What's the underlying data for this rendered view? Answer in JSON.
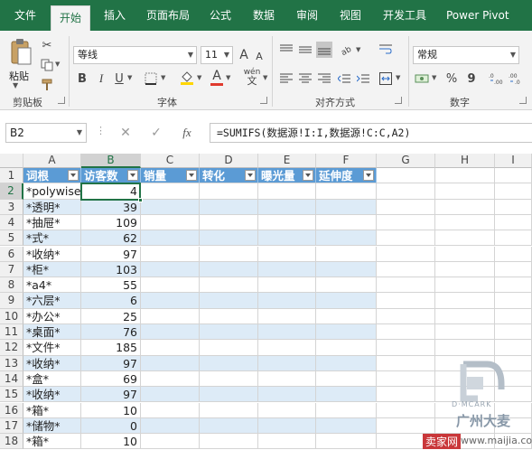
{
  "ribbon": {
    "tabs": [
      "文件",
      "开始",
      "插入",
      "页面布局",
      "公式",
      "数据",
      "审阅",
      "视图",
      "开发工具",
      "Power Pivot"
    ],
    "active_tab": "开始",
    "clipboard": {
      "paste_label": "粘贴",
      "group_label": "剪贴板"
    },
    "font": {
      "name": "等线",
      "size": "11",
      "bold": "B",
      "italic": "I",
      "underline": "U",
      "wen": "wén",
      "grow": "A",
      "shrink": "A",
      "group_label": "字体"
    },
    "alignment": {
      "group_label": "对齐方式"
    },
    "number": {
      "format": "常规",
      "percent": "%",
      "comma": "9",
      "group_label": "数字"
    }
  },
  "formula_bar": {
    "name_box": "B2",
    "fx": "fx",
    "formula": "=SUMIFS(数据源!I:I,数据源!C:C,A2)"
  },
  "sheet": {
    "columns": [
      "A",
      "B",
      "C",
      "D",
      "E",
      "F",
      "G",
      "H",
      "I"
    ],
    "selected_column": "B",
    "selected_row": "2",
    "headers": [
      "词根",
      "访客数",
      "销量",
      "转化",
      "曝光量",
      "延伸度"
    ],
    "row_numbers": [
      "1",
      "2",
      "3",
      "4",
      "5",
      "6",
      "7",
      "8",
      "9",
      "10",
      "11",
      "12",
      "13",
      "14",
      "15",
      "16",
      "17",
      "18"
    ],
    "rows": [
      {
        "word": "*polywise*",
        "visitors": "4"
      },
      {
        "word": "*透明*",
        "visitors": "39"
      },
      {
        "word": "*抽屉*",
        "visitors": "109"
      },
      {
        "word": "*式*",
        "visitors": "62"
      },
      {
        "word": "*收纳*",
        "visitors": "97"
      },
      {
        "word": "*柜*",
        "visitors": "103"
      },
      {
        "word": "*a4*",
        "visitors": "55"
      },
      {
        "word": "*六层*",
        "visitors": "6"
      },
      {
        "word": "*办公*",
        "visitors": "25"
      },
      {
        "word": "*桌面*",
        "visitors": "76"
      },
      {
        "word": "*文件*",
        "visitors": "185"
      },
      {
        "word": "*收纳*",
        "visitors": "97"
      },
      {
        "word": "*盒*",
        "visitors": "69"
      },
      {
        "word": "*收纳*",
        "visitors": "97"
      },
      {
        "word": "*箱*",
        "visitors": "10"
      },
      {
        "word": "*储物*",
        "visitors": "0"
      },
      {
        "word": "*箱*",
        "visitors": "10"
      }
    ]
  },
  "watermark": {
    "brand": "D·MCARK",
    "cn": "广州大麦",
    "site": "www.maijia.com",
    "site_cn": "卖家网"
  },
  "colors": {
    "excel_green": "#217346",
    "table_header_blue": "#5b9bd5",
    "band_blue": "#ddebf7",
    "font_color_red": "#e03a2e",
    "fill_yellow": "#ffd600"
  }
}
